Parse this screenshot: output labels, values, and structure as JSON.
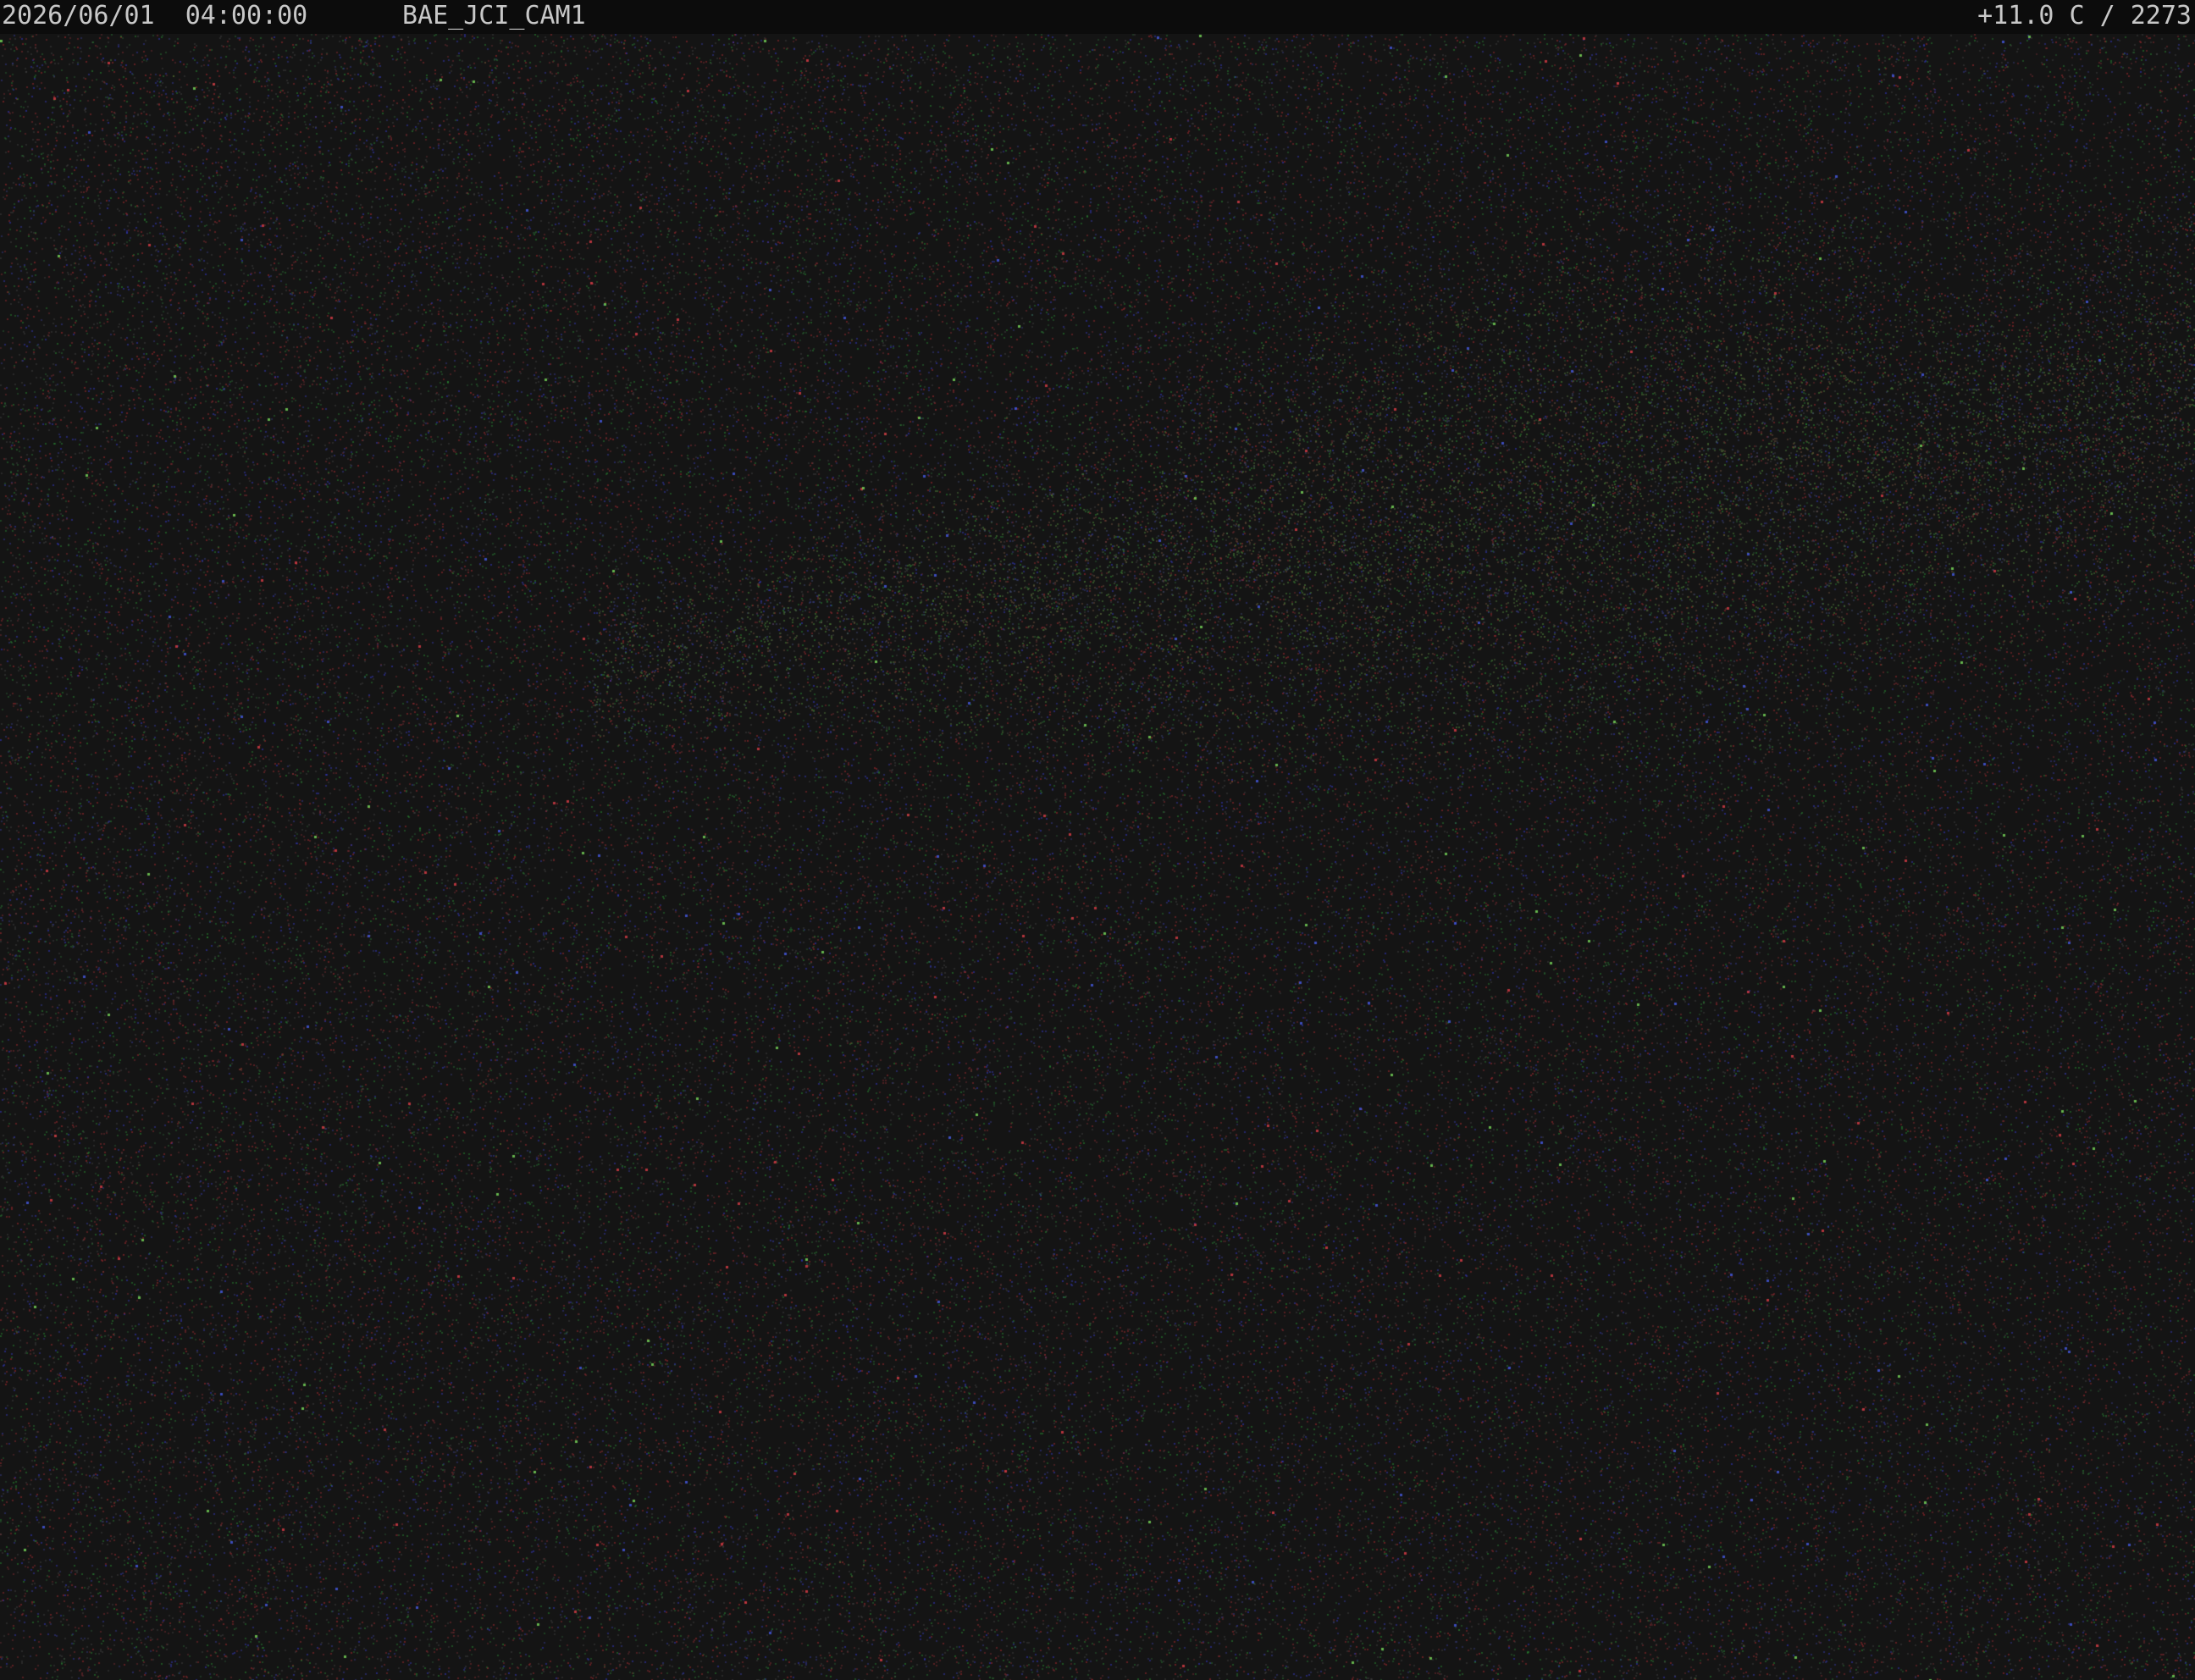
{
  "osd": {
    "datetime": "2026/06/01  04:00:00",
    "camera_name": "BAE_JCI_CAM1",
    "status": "+11.0 C / 2273"
  },
  "scene": {
    "background_color": "#141414",
    "osd_bar_color": "#0c0c0c",
    "osd_text_color": "#c8c8c8",
    "glow_color": "#4a5a3a"
  }
}
